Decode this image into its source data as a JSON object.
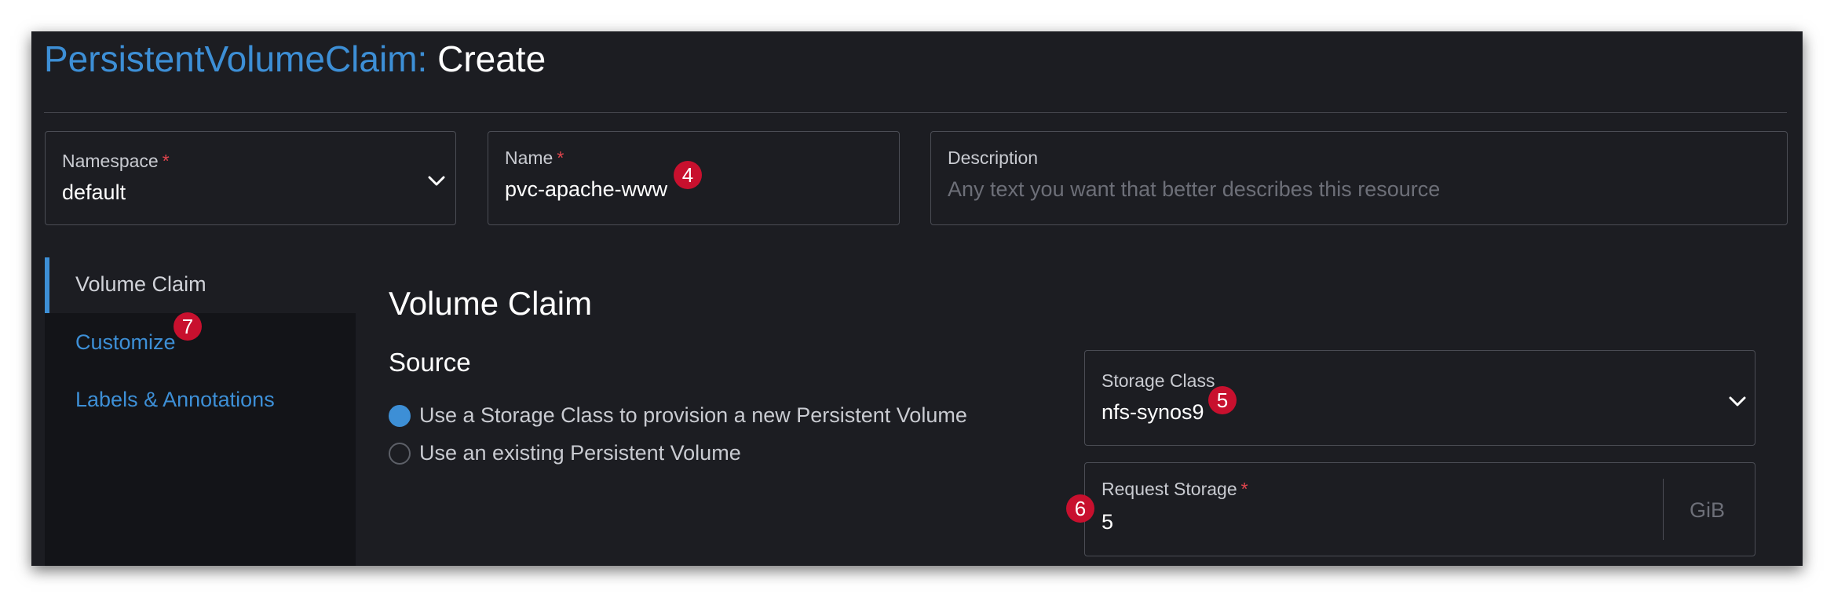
{
  "header": {
    "kind": "PersistentVolumeClaim:",
    "action": "Create"
  },
  "namespace": {
    "label": "Namespace",
    "required_mark": "*",
    "value": "default"
  },
  "name": {
    "label": "Name",
    "required_mark": "*",
    "value": "pvc-apache-www"
  },
  "description": {
    "label": "Description",
    "placeholder": "Any text you want that better describes this resource"
  },
  "sidebar": {
    "items": [
      {
        "label": "Volume Claim",
        "active": true
      },
      {
        "label": "Customize",
        "active": false
      },
      {
        "label": "Labels & Annotations",
        "active": false
      }
    ]
  },
  "main": {
    "section_title": "Volume Claim",
    "source_title": "Source",
    "source_options": [
      {
        "label": "Use a Storage Class to provision a new Persistent Volume",
        "checked": true
      },
      {
        "label": "Use an existing Persistent Volume",
        "checked": false
      }
    ]
  },
  "storage_class": {
    "label": "Storage Class",
    "value": "nfs-synos9"
  },
  "request_storage": {
    "label": "Request Storage",
    "required_mark": "*",
    "value": "5",
    "unit": "GiB"
  },
  "annotations": {
    "badge_4": "4",
    "badge_5": "5",
    "badge_6": "6",
    "badge_7": "7"
  },
  "colors": {
    "background": "#1c1d22",
    "accent": "#3d8fd6",
    "required": "#e0454d",
    "badge": "#c8102e"
  }
}
